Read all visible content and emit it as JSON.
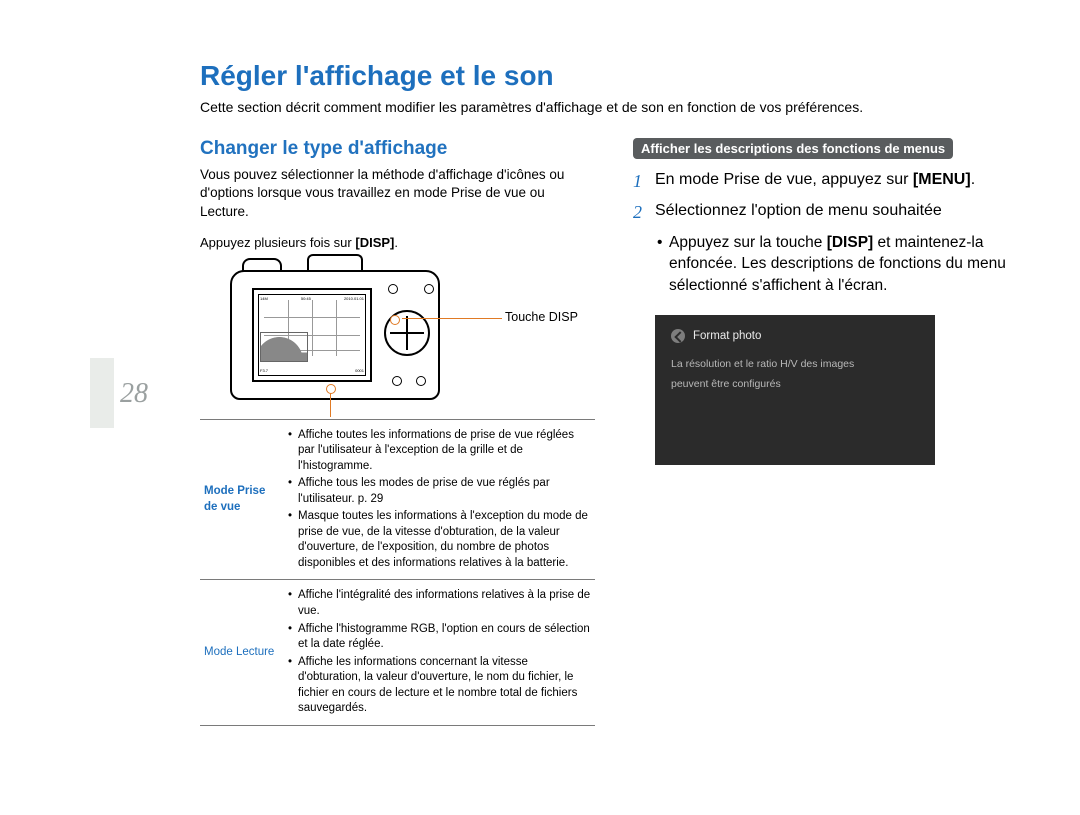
{
  "page_number": "28",
  "main_title": "Régler l'affichage et le son",
  "main_desc": "Cette section décrit comment modifier les paramètres d'affichage et de son en fonction de vos préférences.",
  "left": {
    "heading": "Changer le type d'affichage",
    "intro": "Vous pouvez sélectionner la méthode d'affichage d'icônes ou d'options lorsque vous travaillez en mode Prise de vue ou Lecture.",
    "press_prefix": "Appuyez plusieurs fois sur ",
    "press_key": "DISP",
    "press_suffix": ".",
    "callout_label": "Touche DISP",
    "screen_top_left": "14M",
    "screen_top_mid": "50:45",
    "screen_top_right": "2010.01.01",
    "screen_bottom_left": "F3.7",
    "screen_bottom_right": "0001",
    "modes": [
      {
        "label": "Mode Prise de vue",
        "items": [
          "Affiche toutes les informations de prise de vue réglées par l'utilisateur à l'exception de la grille et de l'histogramme.",
          "Affiche tous les modes de prise de vue réglés par l'utilisateur. p. 29",
          "Masque toutes les informations à l'exception du mode de prise de vue, de la vitesse d'obturation, de la valeur d'ouverture, de l'exposition, du nombre de photos disponibles et des informations relatives à la batterie."
        ]
      },
      {
        "label": "Mode Lecture",
        "items": [
          "Affiche l'intégralité des informations relatives à la prise de vue.",
          "Affiche l'histogramme RGB, l'option en cours de sélection et la date réglée.",
          "Affiche les informations concernant la vitesse d'obturation, la valeur d'ouverture, le nom du fichier, le fichier en cours de lecture et le nombre total de fichiers sauvegardés."
        ]
      }
    ]
  },
  "right": {
    "badge": "Afficher les descriptions des fonctions de menus",
    "step1_text": "En mode Prise de vue, appuyez sur ",
    "step1_key": "MENU",
    "step1_suffix": ".",
    "step2_text": "Sélectionnez l'option de menu souhaitée",
    "sub_prefix": "Appuyez sur la touche ",
    "sub_key": "DISP",
    "sub_suffix": " et maintenez-la enfoncée. Les descriptions de fonctions du menu sélectionné s'affichent à l'écran.",
    "preview": {
      "title": "Format photo",
      "line1": "La résolution et le ratio H/V des images",
      "line2": "peuvent être configurés"
    }
  }
}
